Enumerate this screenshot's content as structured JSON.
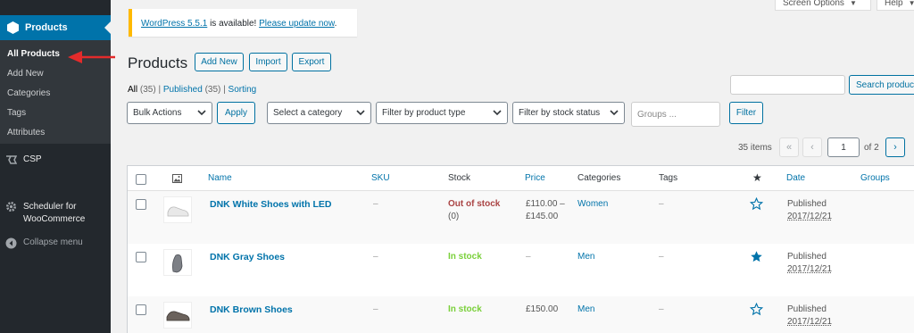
{
  "sidebar": {
    "products_label": "Products",
    "submenu": [
      "All Products",
      "Add New",
      "Categories",
      "Tags",
      "Attributes"
    ],
    "csp_label": "CSP",
    "scheduler_label_1": "Scheduler for",
    "scheduler_label_2": "WooCommerce",
    "collapse_label": "Collapse menu"
  },
  "topbar": {
    "screen_options": "Screen Options",
    "help": "Help"
  },
  "notice": {
    "version_link": "WordPress 5.5.1",
    "text": " is available! ",
    "update_link": "Please update now",
    "dot": "."
  },
  "header": {
    "title": "Products",
    "add_new": "Add New",
    "import": "Import",
    "export": "Export"
  },
  "views": {
    "all": "All",
    "all_count": "(35)",
    "published": "Published",
    "published_count": "(35)",
    "sorting": "Sorting",
    "sep": "|"
  },
  "search": {
    "button": "Search products"
  },
  "filters": {
    "bulk_actions": "Bulk Actions",
    "apply": "Apply",
    "category": "Select a category",
    "product_type": "Filter by product type",
    "stock_status": "Filter by stock status",
    "groups_placeholder": "Groups ...",
    "filter_button": "Filter"
  },
  "pagination": {
    "items": "35 items",
    "first": "«",
    "prev": "‹",
    "current": "1",
    "of": "of 2",
    "next": "›"
  },
  "table": {
    "columns": [
      "Name",
      "SKU",
      "Stock",
      "Price",
      "Categories",
      "Tags",
      "Date",
      "Groups"
    ],
    "rows": [
      {
        "name": "DNK White Shoes with LED",
        "sku": "–",
        "stock": "Out of stock",
        "stock_sub": "(0)",
        "price_1": "£110.00 –",
        "price_2": "£145.00",
        "category": "Women",
        "tags": "–",
        "featured": false,
        "date_status": "Published",
        "date": "2017/12/21"
      },
      {
        "name": "DNK Gray Shoes",
        "sku": "–",
        "stock": "In stock",
        "stock_sub": "",
        "price_1": "–",
        "price_2": "",
        "category": "Men",
        "tags": "–",
        "featured": true,
        "date_status": "Published",
        "date": "2017/12/21"
      },
      {
        "name": "DNK Brown Shoes",
        "sku": "–",
        "stock": "In stock",
        "stock_sub": "",
        "price_1": "£150.00",
        "price_2": "",
        "category": "Men",
        "tags": "–",
        "featured": false,
        "date_status": "Published",
        "date": "2017/12/21"
      }
    ]
  },
  "colors": {
    "sidebar": "#23282d",
    "accent": "#0073aa",
    "notice": "#ffb900",
    "out_of_stock": "#a44444",
    "in_stock": "#7ad03a",
    "arrow": "#e32b2b"
  }
}
